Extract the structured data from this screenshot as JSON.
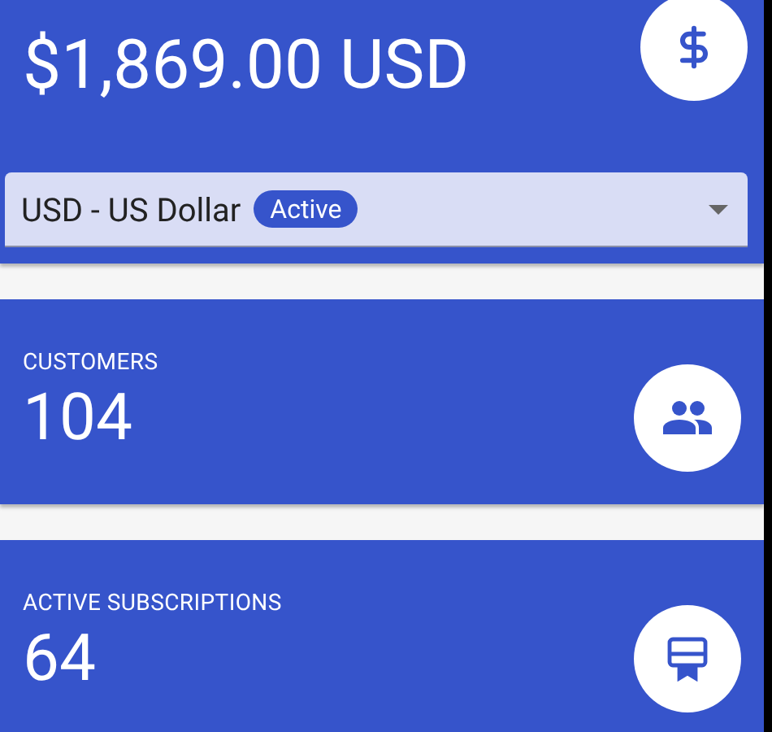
{
  "cards": [
    {
      "kind": "earnings",
      "value": "$1,869.00 USD",
      "select": {
        "value": "USD - US Dollar",
        "badge": "Active"
      }
    },
    {
      "kind": "stat",
      "label": "CUSTOMERS",
      "value": "104"
    },
    {
      "kind": "stat",
      "label": "ACTIVE SUBSCRIPTIONS",
      "value": "64"
    }
  ]
}
